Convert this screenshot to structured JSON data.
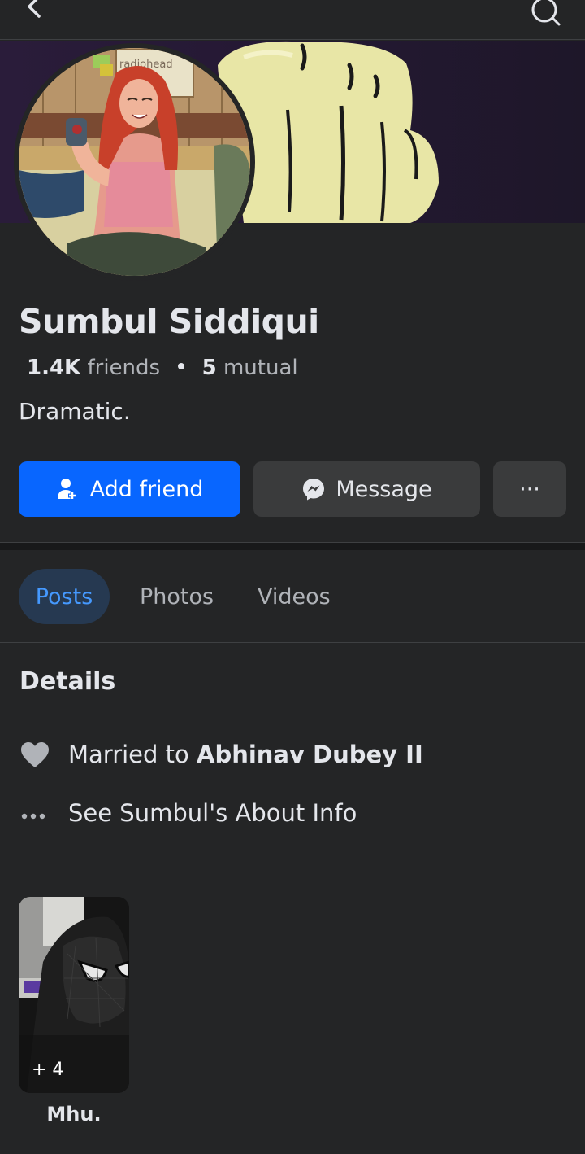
{
  "profile": {
    "name": "Sumbul Siddiqui",
    "friends_count": "1.4K",
    "friends_label": "friends",
    "mutual_count": "5",
    "mutual_label": "mutual",
    "bio": "Dramatic."
  },
  "avatar_art": {
    "poster_text": "radiohead"
  },
  "actions": {
    "add_friend": "Add friend",
    "message": "Message",
    "more": "···"
  },
  "tabs": [
    {
      "label": "Posts",
      "selected": true
    },
    {
      "label": "Photos",
      "selected": false
    },
    {
      "label": "Videos",
      "selected": false
    }
  ],
  "details": {
    "title": "Details",
    "married_prefix": "Married to",
    "married_name": "Abhinav Dubey II",
    "about_link": "See Sumbul's About Info"
  },
  "featured": {
    "count": "+ 4",
    "label": "Mhu."
  },
  "icons": {
    "back": "chevron-left-icon",
    "search": "search-icon",
    "add_friend": "add-person-icon",
    "message": "messenger-icon",
    "relationship": "heart-icon",
    "about": "more-dots-icon"
  },
  "colors": {
    "background": "#242526",
    "primary_button": "#0866ff",
    "secondary_button": "#3a3b3c",
    "tab_active_bg": "#263951",
    "tab_active_text": "#4599ff"
  }
}
